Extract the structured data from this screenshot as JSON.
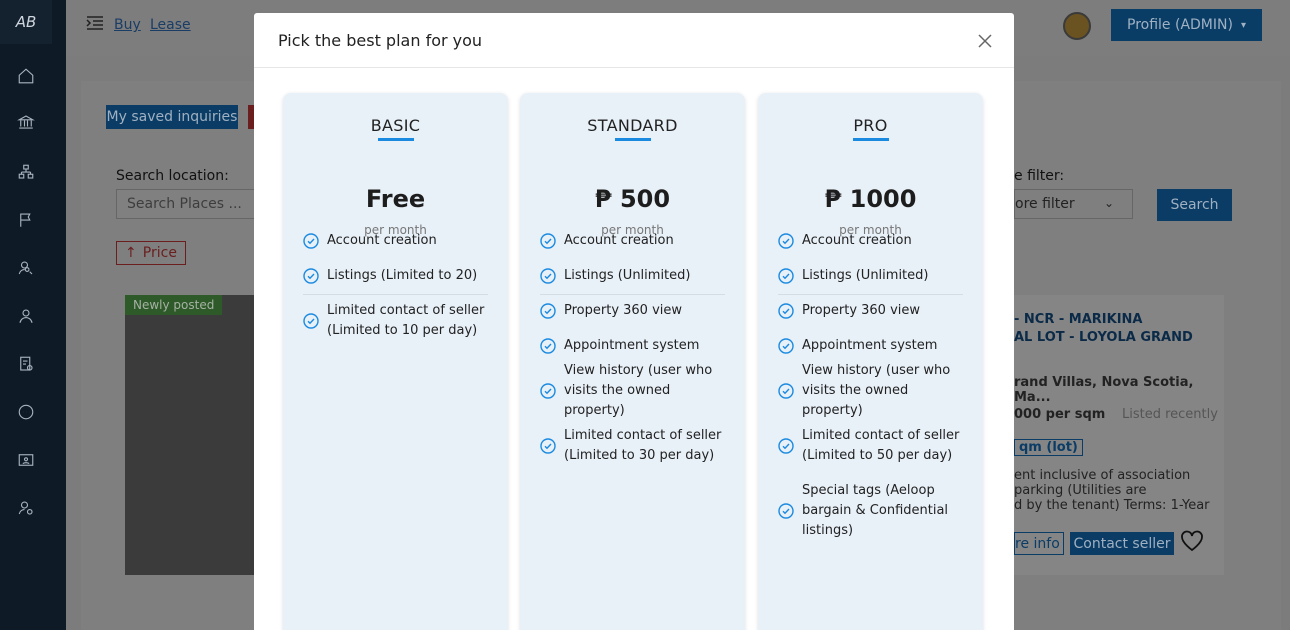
{
  "app": {
    "logo_text": "AB",
    "nav": {
      "buy": "Buy",
      "lease": "Lease"
    },
    "profile_label": "Profile (ADMIN)"
  },
  "background": {
    "saved_inquiries": "My saved inquiries",
    "search_location_label": "Search location:",
    "search_placeholder": "Search Places ...",
    "price_sort": "Price",
    "filter_label": "e filter:",
    "filter_value": "ore filter",
    "search_button": "Search",
    "newly_posted": "Newly posted",
    "listing": {
      "title_line1": "- NCR - MARIKINA",
      "title_line2": "AL LOT - LOYOLA GRAND",
      "address": "rand Villas, Nova Scotia, Ma...",
      "price": "000 per sqm",
      "listed": "Listed recently",
      "area_badge": "qm (lot)",
      "desc_line1": "ent inclusive of association",
      "desc_line2": "parking (Utilities are",
      "desc_line3": "d by the tenant) Terms:  1-Year",
      "more_info": "re info",
      "contact": "Contact seller"
    }
  },
  "modal": {
    "title": "Pick the best plan for you",
    "plans": [
      {
        "name": "BASIC",
        "price": "Free",
        "period": "per month",
        "features": [
          "Account creation",
          "Listings (Limited to 20)",
          "Limited contact of seller (Limited to 10 per day)"
        ]
      },
      {
        "name": "STANDARD",
        "price": "₱ 500",
        "period": "per month",
        "features": [
          "Account creation",
          "Listings (Unlimited)",
          "Property 360 view",
          "Appointment system",
          "View history (user who visits the owned property)",
          "Limited contact of seller (Limited to 30 per day)"
        ]
      },
      {
        "name": "PRO",
        "price": "₱ 1000",
        "period": "per month",
        "features": [
          "Account creation",
          "Listings (Unlimited)",
          "Property 360 view",
          "Appointment system",
          "View history (user who visits the owned property)",
          "Limited contact of seller (Limited to 50 per day)",
          "Special tags (Aeloop bargain & Confidential listings)"
        ]
      }
    ]
  },
  "colors": {
    "accent": "#1a8ae0",
    "plan_card_bg": "#e8f0f8",
    "sidebar_bg": "#0e1a26",
    "profile_button_bg": "#0a3d66"
  }
}
